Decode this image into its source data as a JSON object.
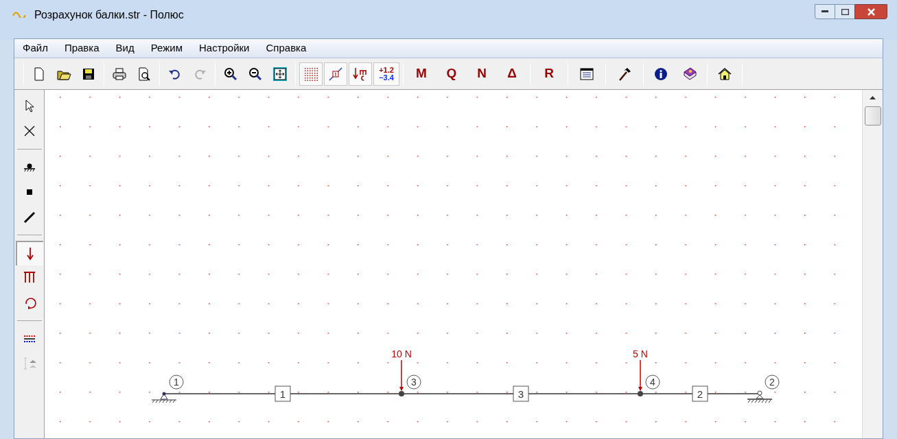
{
  "window": {
    "title": "Розрахунок балки.str - Полюс"
  },
  "menu": [
    {
      "label": "Файл"
    },
    {
      "label": "Правка"
    },
    {
      "label": "Вид"
    },
    {
      "label": "Режим"
    },
    {
      "label": "Настройки"
    },
    {
      "label": "Справка"
    }
  ],
  "view_toggles": [
    {
      "kind": "grid",
      "pressed": true
    },
    {
      "kind": "numbers",
      "pressed": true
    },
    {
      "kind": "loads",
      "pressed": true
    },
    {
      "kind": "values",
      "pressed": true,
      "line_1": "+1.2",
      "line_2": "−3.4"
    }
  ],
  "diagram_buttons": [
    {
      "label": "M"
    },
    {
      "label": "Q"
    },
    {
      "label": "N"
    },
    {
      "label": "Δ"
    }
  ],
  "reactions_button": {
    "label": "R"
  },
  "tool_groups": [
    [
      {
        "kind": "pointer",
        "selected": false,
        "disabled": false
      },
      {
        "kind": "delete",
        "selected": false,
        "disabled": false
      }
    ],
    [
      {
        "kind": "support",
        "selected": false,
        "disabled": false
      },
      {
        "kind": "node",
        "selected": false,
        "disabled": false
      },
      {
        "kind": "bar",
        "selected": false,
        "disabled": false
      }
    ],
    [
      {
        "kind": "force",
        "selected": true,
        "disabled": false
      },
      {
        "kind": "distributed",
        "selected": false,
        "disabled": false
      },
      {
        "kind": "moment",
        "selected": false,
        "disabled": false
      }
    ],
    [
      {
        "kind": "layers",
        "selected": false,
        "disabled": false
      },
      {
        "kind": "dimension",
        "selected": false,
        "disabled": true
      }
    ]
  ],
  "beam": {
    "nodes": [
      {
        "label": "1",
        "kind": "pin"
      },
      {
        "label": "3",
        "kind": "joint",
        "load": "10 N"
      },
      {
        "label": "4",
        "kind": "joint",
        "load": "5 N"
      },
      {
        "label": "2",
        "kind": "roller"
      }
    ],
    "elements": [
      {
        "label": "1"
      },
      {
        "label": "3"
      },
      {
        "label": "2"
      }
    ]
  }
}
